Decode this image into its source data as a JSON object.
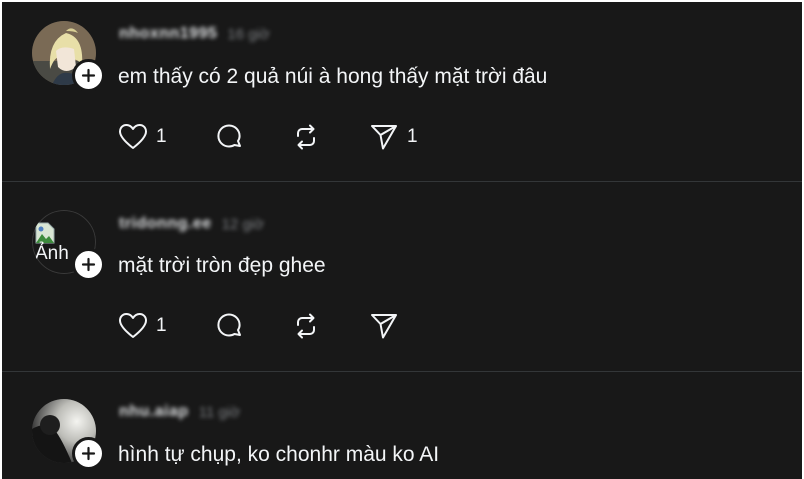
{
  "comments": [
    {
      "username": "nhoxnn1995",
      "time": "16 giờ",
      "text": "em thấy có 2 quả núi à hong thấy mặt trời đâu",
      "like_count": "1",
      "share_count": "1",
      "avatar_icon": "anime-avatar"
    },
    {
      "username": "tridonng.ee",
      "time": "12 giờ",
      "text": "mặt trời tròn đẹp ghee",
      "like_count": "1",
      "share_count": "",
      "avatar_alt": "Ảnh",
      "avatar_icon": "broken-image-icon"
    },
    {
      "username": "nhu.aiap",
      "time": "11 giờ",
      "text": "hình tự chụp, ko chonhr màu ko AI",
      "like_count": "",
      "share_count": "",
      "avatar_icon": "photo-avatar"
    }
  ],
  "colors": {
    "background": "#181818",
    "text": "#f3f5f7",
    "muted": "#8a8d91",
    "divider": "#333638"
  }
}
